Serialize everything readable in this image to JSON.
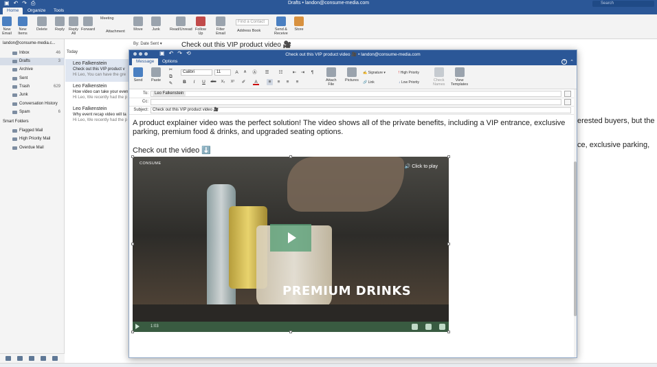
{
  "main": {
    "window_title": "Drafts • landon@consume-media.com",
    "search_placeholder": "Search",
    "tabs": [
      "Home",
      "Organize",
      "Tools"
    ],
    "ribbon": [
      {
        "label": "New\nEmail",
        "icon": "new-email-icon"
      },
      {
        "label": "New\nItems",
        "icon": "new-items-icon"
      },
      {
        "label": "Delete",
        "icon": "delete-icon"
      },
      {
        "label": "Reply",
        "icon": "reply-icon"
      },
      {
        "label": "Reply\nAll",
        "icon": "reply-all-icon"
      },
      {
        "label": "Forward",
        "icon": "forward-icon"
      },
      {
        "label": "Meeting",
        "icon": "meeting-icon"
      },
      {
        "label": "Attachment",
        "icon": "attachment-icon"
      },
      {
        "label": "Move",
        "icon": "move-icon"
      },
      {
        "label": "Junk",
        "icon": "junk-icon"
      },
      {
        "label": "Read/Unread",
        "icon": "read-unread-icon"
      },
      {
        "label": "Follow\nUp",
        "icon": "follow-up-icon"
      },
      {
        "label": "Filter\nEmail",
        "icon": "filter-icon"
      },
      {
        "label": "Address Book",
        "icon": "address-book-icon"
      },
      {
        "label": "Send &\nReceive",
        "icon": "send-receive-icon"
      },
      {
        "label": "Store",
        "icon": "store-icon"
      }
    ],
    "find_contact_placeholder": "Find a Contact",
    "sort_label": "By: Date Sent"
  },
  "sidebar": {
    "account": "landon@consume-media.c...",
    "folders": [
      {
        "label": "Inbox",
        "count": "46"
      },
      {
        "label": "Drafts",
        "count": "3"
      },
      {
        "label": "Archive",
        "count": ""
      },
      {
        "label": "Sent",
        "count": ""
      },
      {
        "label": "Trash",
        "count": "629"
      },
      {
        "label": "Junk",
        "count": ""
      },
      {
        "label": "Conversation History",
        "count": ""
      },
      {
        "label": "Spam",
        "count": "6"
      }
    ],
    "smart_header": "Smart Folders",
    "smart_folders": [
      "Flagged Mail",
      "High Priority Mail",
      "Overdue Mail"
    ]
  },
  "message_list": {
    "group": "Today",
    "messages": [
      {
        "from": "Leo Falkenstein",
        "subject": "Check out this VIP product v",
        "preview": "Hi Leo, You can have the gre"
      },
      {
        "from": "Leo Falkenstein",
        "subject": "How video can take your even",
        "preview": "Hi Leo, We recently had the p"
      },
      {
        "from": "Leo Falkenstein",
        "subject": "Why event recap video will ta",
        "preview": "Hi Leo, We recently had the p"
      }
    ]
  },
  "reading_pane": {
    "subject": "Check out this VIP product video 🎥",
    "fragment1": "erested buyers, but the",
    "fragment2": "ce, exclusive parking,"
  },
  "compose": {
    "title": "Check out this VIP product video 🎥 • landon@consume-media.com",
    "tabs": [
      "Message",
      "Options"
    ],
    "font_name": "Calibri",
    "font_size": "11",
    "buttons": {
      "send": "Send",
      "paste": "Paste",
      "attach": "Attach\nFile",
      "pictures": "Pictures",
      "signature": "Signature",
      "link": "Link",
      "high_priority": "High Priority",
      "low_priority": "Low Priority",
      "check_names": "Check\nNames",
      "view_templates": "View\nTemplates"
    },
    "to_label": "To:",
    "to_value": "Leo Falkenstein",
    "cc_label": "Cc:",
    "subject_label": "Subject:",
    "subject_value": "Check out this VIP product video 🎥",
    "body_paragraph": "A product explainer video was the perfect solution! The video shows all of the private benefits, including a VIP entrance, exclusive parking, premium food & drinks, and upgraded seating options.",
    "body_heading": "Check out the video ⬇️",
    "video": {
      "brand": "CONSUME",
      "click_to_play": "🔊 Click to play",
      "caption": "PREMIUM DRINKS",
      "time": "1:03"
    }
  }
}
